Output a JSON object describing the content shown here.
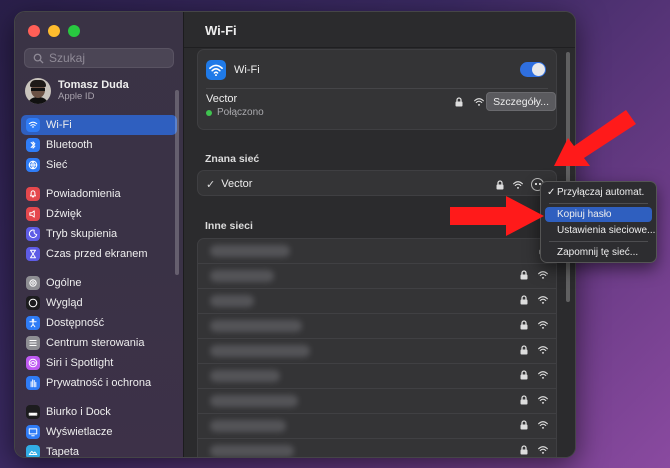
{
  "window": {
    "title": "Wi-Fi"
  },
  "sidebar": {
    "search_placeholder": "Szukaj",
    "user": {
      "name": "Tomasz Duda",
      "subtitle": "Apple ID"
    },
    "groups": [
      [
        {
          "label": "Wi-Fi",
          "icon": "wifi-icon",
          "color": "#2f7cf6",
          "active": true
        },
        {
          "label": "Bluetooth",
          "icon": "bluetooth-icon",
          "color": "#2f7cf6"
        },
        {
          "label": "Sieć",
          "icon": "globe-icon",
          "color": "#2f7cf6"
        }
      ],
      [
        {
          "label": "Powiadomienia",
          "icon": "bell-icon",
          "color": "#e5484d"
        },
        {
          "label": "Dźwięk",
          "icon": "speaker-icon",
          "color": "#e5484d"
        },
        {
          "label": "Tryb skupienia",
          "icon": "moon-icon",
          "color": "#5e5ce6"
        },
        {
          "label": "Czas przed ekranem",
          "icon": "hourglass-icon",
          "color": "#5e5ce6"
        }
      ],
      [
        {
          "label": "Ogólne",
          "icon": "gear-icon",
          "color": "#8e8e93"
        },
        {
          "label": "Wygląd",
          "icon": "appearance-icon",
          "color": "#1c1c1e"
        },
        {
          "label": "Dostępność",
          "icon": "accessibility-icon",
          "color": "#2f7cf6"
        },
        {
          "label": "Centrum sterowania",
          "icon": "control-center-icon",
          "color": "#8e8e93"
        },
        {
          "label": "Siri i Spotlight",
          "icon": "siri-icon",
          "color": "#bf5af2"
        },
        {
          "label": "Prywatność i ochrona",
          "icon": "hand-icon",
          "color": "#2f7cf6"
        }
      ],
      [
        {
          "label": "Biurko i Dock",
          "icon": "dock-icon",
          "color": "#1c1c1e"
        },
        {
          "label": "Wyświetlacze",
          "icon": "display-icon",
          "color": "#2f7cf6"
        },
        {
          "label": "Tapeta",
          "icon": "wallpaper-icon",
          "color": "#32ade6"
        }
      ]
    ]
  },
  "main": {
    "title": "Wi-Fi",
    "wifi_label": "Wi-Fi",
    "wifi_on": true,
    "current": {
      "name": "Vector",
      "status": "Połączono",
      "details_label": "Szczegóły..."
    },
    "known_title": "Znana sieć",
    "known": [
      {
        "name": "Vector",
        "checked": true
      }
    ],
    "others_title": "Inne sieci",
    "others_count": 9
  },
  "context_menu": {
    "items": [
      {
        "label": "Przyłączaj automat.",
        "checked": true
      },
      {
        "label": "Kopiuj hasło",
        "highlighted": true
      },
      {
        "label": "Ustawienia sieciowe..."
      },
      {
        "label": "Zapomnij tę sieć..."
      }
    ]
  },
  "colors": {
    "accent": "#2f5fbf",
    "arrow": "#ff1a1a",
    "status_green": "#3fc34f"
  }
}
